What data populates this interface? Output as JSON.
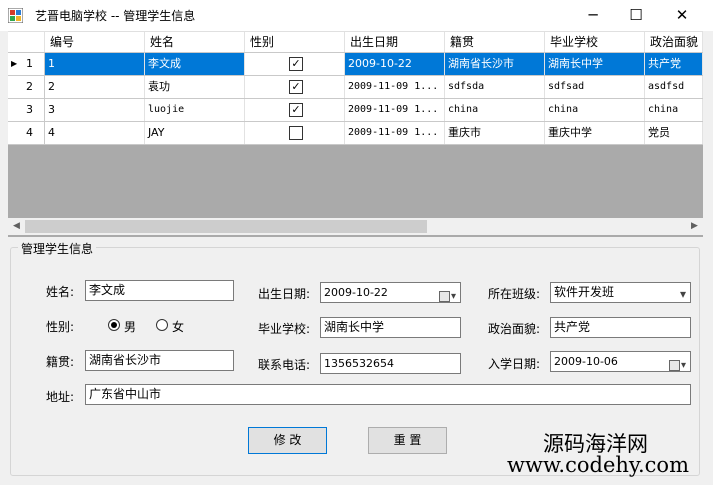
{
  "window": {
    "title": "艺晋电脑学校 -- 管理学生信息",
    "minimize_glyph": "─",
    "maximize_glyph": "☐",
    "close_glyph": "✕",
    "icon": "app-form-icon"
  },
  "grid": {
    "columns": [
      "编号",
      "姓名",
      "性别",
      "出生日期",
      "籍贯",
      "毕业学校",
      "政治面貌"
    ],
    "selected_marker": "▶",
    "rows": [
      {
        "num": "1",
        "id": "1",
        "name": "李文成",
        "gender_checked": true,
        "birth": "2009-10-22",
        "origin": "湖南省长沙市",
        "school": "湖南长中学",
        "politics": "共产党"
      },
      {
        "num": "2",
        "id": "2",
        "name": "袁功",
        "gender_checked": true,
        "birth": "2009-11-09 1...",
        "origin": "sdfsda",
        "school": "sdfsad",
        "politics": "asdfsd"
      },
      {
        "num": "3",
        "id": "3",
        "name": "luojie",
        "gender_checked": true,
        "birth": "2009-11-09 1...",
        "origin": "china",
        "school": "china",
        "politics": "china"
      },
      {
        "num": "4",
        "id": "4",
        "name": "JAY",
        "gender_checked": false,
        "birth": "2009-11-09 1...",
        "origin": "重庆市",
        "school": "重庆中学",
        "politics": "党员"
      }
    ],
    "scroll_left": "◀",
    "scroll_right": "▶"
  },
  "form": {
    "group_title": "管理学生信息",
    "name_label": "姓名:",
    "name_value": "李文成",
    "gender_label": "性别:",
    "male_label": "男",
    "female_label": "女",
    "gender_selected": "男",
    "origin_label": "籍贯:",
    "origin_value": "湖南省长沙市",
    "address_label": "地址:",
    "address_value": "广东省中山市",
    "birth_label": "出生日期:",
    "birth_value": "2009-10-22",
    "school_label": "毕业学校:",
    "school_value": "湖南长中学",
    "phone_label": "联系电话:",
    "phone_value": "1356532654",
    "class_label": "所在班级:",
    "class_value": "软件开发班",
    "politics_label": "政治面貌:",
    "politics_value": "共产党",
    "enroll_label": "入学日期:",
    "enroll_value": "2009-10-06",
    "dropdown_glyph": "▾",
    "modify_button": "修 改",
    "reset_button": "重 置"
  },
  "watermark": {
    "line1": "源码海洋网",
    "line2": "www.codehy.com"
  }
}
